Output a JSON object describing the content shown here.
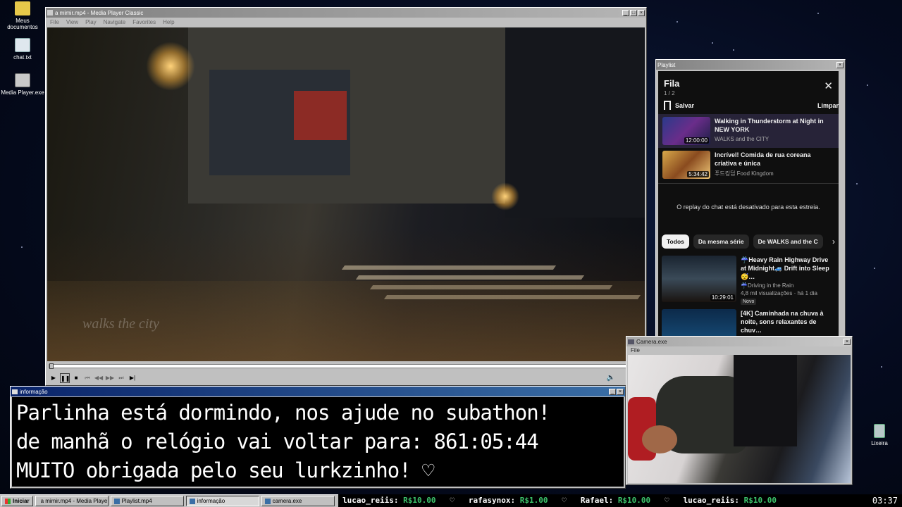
{
  "desktop": {
    "icons": [
      {
        "label": "Meus documentos"
      },
      {
        "label": "chat.txt"
      },
      {
        "label": "Media Player.exe"
      },
      {
        "label": "Lixeira"
      }
    ]
  },
  "mpc": {
    "title": "a mimir.mp4 - Media Player Classic",
    "menu": [
      "File",
      "View",
      "Play",
      "Navigate",
      "Favorites",
      "Help"
    ],
    "watermark": "walks the city"
  },
  "playlist_window": {
    "title": "Playlist",
    "heading": "Fila",
    "count": "1 / 2",
    "save_label": "Salvar",
    "clear_label": "Limpar",
    "items": [
      {
        "title": "Walking in Thunderstorm at Night in NEW YORK",
        "channel": "WALKS and the CITY",
        "duration": "12:00:00"
      },
      {
        "title": "Incrível! Comida de rua coreana criativa e única",
        "channel": "푸드킹덤 Food Kingdom",
        "duration": "5:34:42"
      }
    ],
    "chat_replay_notice": "O replay do chat está desativado para esta estreia.",
    "chips": [
      "Todos",
      "Da mesma série",
      "De WALKS and the C"
    ],
    "recommendations": [
      {
        "title": "☔Heavy Rain Highway Drive at Midnight🚙 Drift into Sleep😴…",
        "channel": "☔Driving in the Rain",
        "meta": "4,8 mil visualizações · há 1 dia",
        "badge": "Novo",
        "duration": "10:29:01"
      },
      {
        "title": "[4K] Caminhada na chuva à noite, sons relaxantes de chuv…",
        "channel": "",
        "meta": "",
        "badge": "",
        "duration": ""
      }
    ]
  },
  "info_window": {
    "title": "informação",
    "lines": [
      "Parlinha está dormindo, nos ajude no subathon!",
      "de manhã o relógio vai voltar para:  861:05:44",
      "MUITO obrigada pelo seu lurkzinho! ♡"
    ]
  },
  "camera_window": {
    "title": "Camera.exe",
    "menu": [
      "File"
    ]
  },
  "taskbar": {
    "start_label": "Iniciar",
    "buttons": [
      {
        "label": "a mimir.mp4 - Media Playe..."
      },
      {
        "label": "Playlist.mp4"
      },
      {
        "label": "informação"
      },
      {
        "label": "camera.exe"
      }
    ],
    "ticker": [
      {
        "user": "lucao_reiis:",
        "amount": "R$10.00"
      },
      {
        "user": "rafasynox:",
        "amount": "R$1.00"
      },
      {
        "user": "Rafael:",
        "amount": "R$10.00"
      },
      {
        "user": "lucao_reiis:",
        "amount": "R$10.00"
      }
    ],
    "clock": "03:37"
  }
}
